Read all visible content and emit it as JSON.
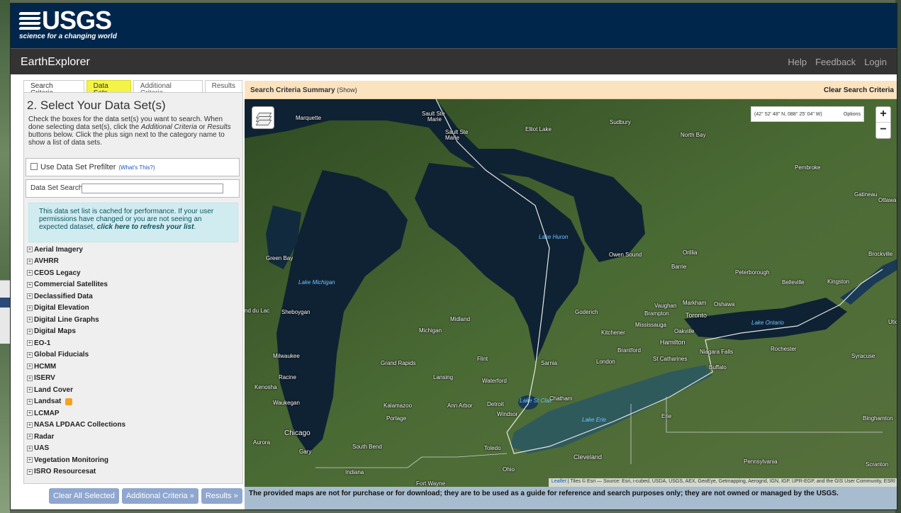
{
  "usgs": {
    "logo_text": "USGS",
    "tagline": "science for a changing world"
  },
  "navbar": {
    "title": "EarthExplorer",
    "links": [
      "Help",
      "Feedback",
      "Login"
    ]
  },
  "tabs": [
    "Search Criteria",
    "Data Sets",
    "Additional Criteria",
    "Results"
  ],
  "active_tab": "Data Sets",
  "panel": {
    "step_title": "2. Select Your Data Set(s)",
    "instructions_a": "Check the boxes for the data set(s) you want to search. When done selecting data set(s), click the ",
    "instructions_b": "Additional Criteria",
    "instructions_c": " or ",
    "instructions_d": "Results",
    "instructions_e": " buttons below. Click the plus sign next to the category name to show a list of data sets.",
    "prefilter_label": "Use Data Set Prefilter",
    "prefilter_help": "(What's This?)",
    "search_label": "Data Set Search:",
    "search_value": "",
    "cache_note_a": "This data set list is cached for performance. If your user permissions have changed or you are not seeing an expected dataset, ",
    "cache_note_link": "click here to refresh your list",
    "cache_note_end": "."
  },
  "datasets": [
    "Aerial Imagery",
    "AVHRR",
    "CEOS Legacy",
    "Commercial Satellites",
    "Declassified Data",
    "Digital Elevation",
    "Digital Line Graphs",
    "Digital Maps",
    "EO-1",
    "Global Fiducials",
    "HCMM",
    "ISERV",
    "Land Cover",
    "Landsat",
    "LCMAP",
    "NASA LPDAAC Collections",
    "Radar",
    "UAS",
    "Vegetation Monitoring",
    "ISRO Resourcesat"
  ],
  "buttons": {
    "clear": "Clear All Selected",
    "additional": "Additional Criteria »",
    "results": "Results »"
  },
  "summary": {
    "label": "Search Criteria Summary",
    "show": "(Show)",
    "clear": "Clear Search Criteria"
  },
  "map": {
    "coords": "(42° 52' 48\" N, 088° 25' 04\" W)",
    "options": "Options",
    "zoom_in": "+",
    "zoom_out": "−",
    "attribution_link": "Leaflet",
    "attribution": " | Tiles © Esri — Source: Esri, i-cubed, USDA, USGS, AEX, GeoEye, Getmapping, Aerogrid, IGN, IGP, UPR-EGP, and the GIS User Community, ESRI",
    "labels": {
      "marquette": "Marquette",
      "sault1": "Sault Ste",
      "sault1b": "Marie",
      "sault2": "Sault Ste",
      "sault2b": "Marie",
      "elliot": "Elliot Lake",
      "sudbury": "Sudbury",
      "northbay": "North Bay",
      "pembroke": "Pembroke",
      "gatineau": "Gatineau",
      "ottawa": "Ottawa",
      "lakehuron": "Lake Huron",
      "greenbay": "Green Bay",
      "lakemichigan": "Lake Michigan",
      "owensound": "Owen Sound",
      "orillia": "Orillia",
      "barrie": "Barrie",
      "peterborough": "Peterborough",
      "brockville": "Brockville",
      "belleville": "Belleville",
      "kingston": "Kingston",
      "fonddulac": "nd du Lac",
      "sheboygan": "Sheboygan",
      "midland": "Midland",
      "goderich": "Goderich",
      "vaughan": "Vaughan",
      "markham": "Markham",
      "oshawa": "Oshawa",
      "brampton": "Brampton",
      "toronto": "Toronto",
      "lakeontario": "Lake Ontario",
      "mississauga": "Mississauga",
      "oakville": "Oakville",
      "kitchener": "Kitchener",
      "hamilton": "Hamilton",
      "michigan": "Michigan",
      "milwaukee": "Milwaukee",
      "brantford": "Brantford",
      "stcath": "St Catharines",
      "niagara": "Niagara Falls",
      "rochester": "Rochester",
      "syracuse": "Syracuse",
      "grandrapids": "Grand Rapids",
      "flint": "Flint",
      "sarnia": "Sarnia",
      "london": "London",
      "buffalo": "Buffalo",
      "racine": "Racine",
      "kenosha": "Kenosha",
      "lansing": "Lansing",
      "waterford": "Waterford",
      "waukegan": "Waukegan",
      "chatham": "Chatham",
      "lakestclair": "Lake St Clair",
      "kalamazoo": "Kalamazoo",
      "annarbor": "Ann Arbor",
      "detroit": "Detroit",
      "windsor": "Windsor",
      "portage": "Portage",
      "lakeerie": "Lake Erie",
      "erie": "Erie",
      "binghamton": "Binghamton",
      "chicago": "Chicago",
      "aurora": "Aurora",
      "gary": "Gary",
      "southbend": "South Bend",
      "toledo": "Toledo",
      "cleveland": "Cleveland",
      "pennsylvania": "Pennsylvania",
      "indiana": "Indiana",
      "ohio": "Ohio",
      "fortwayne": "Fort Wayne",
      "scranton": "Scranton",
      "utica": "Utica"
    }
  },
  "disclaimer": "The provided maps are not for purchase or for download; they are to be used as a guide for reference and search purposes only; they are not owned or managed by the USGS.",
  "colors": {
    "banner": "#00264c",
    "navbar": "#333333",
    "active_tab": "#f4f446",
    "summary_bar": "#fbe3c0",
    "disclaimer_bar": "#a8bccf",
    "button": "#8fa6cf",
    "water": "#0f2233",
    "land": "#3e5a2c"
  }
}
